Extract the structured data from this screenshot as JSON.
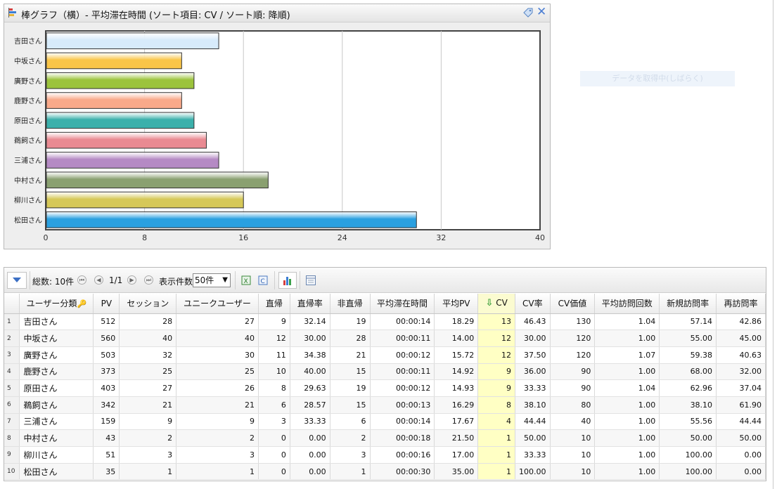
{
  "chart_panel": {
    "title": "棒グラフ（横）- 平均滞在時間 (ソート項目: CV / ソート順: 降順)"
  },
  "chart_data": {
    "type": "bar",
    "orientation": "horizontal",
    "categories": [
      "吉田さん",
      "中坂さん",
      "廣野さん",
      "鹿野さん",
      "原田さん",
      "鵜飼さん",
      "三浦さん",
      "中村さん",
      "柳川さん",
      "松田さん"
    ],
    "values": [
      14,
      11,
      12,
      11,
      12,
      13,
      14,
      18,
      16,
      30
    ],
    "xlim": [
      0,
      40
    ],
    "xticks": [
      "0",
      "8",
      "16",
      "24",
      "32",
      "40"
    ],
    "colors": [
      "#d7ebfb",
      "#f9c548",
      "#9cc33c",
      "#f9a98a",
      "#3bb0ab",
      "#e98a92",
      "#b58ac4",
      "#8aa070",
      "#d6c858",
      "#2aa0e0"
    ],
    "grid": true
  },
  "loading_stub": {
    "text": "データを取得中(しばらく)"
  },
  "toolbar": {
    "total_label": "総数: 10件",
    "page_label": "1/1",
    "page_size_label": "表示件数",
    "page_size_value": "50件"
  },
  "grid": {
    "columns": [
      "ユーザー分類",
      "PV",
      "セッション",
      "ユニークユーザー",
      "直帰",
      "直帰率",
      "非直帰",
      "平均滞在時間",
      "平均PV",
      "CV",
      "CV率",
      "CV価値",
      "平均訪問回数",
      "新規訪問率",
      "再訪問率"
    ],
    "rows": [
      {
        "n": "1",
        "name": "吉田さん",
        "pv": "512",
        "ses": "28",
        "uu": "27",
        "bnc": "9",
        "bncr": "32.14",
        "nbnc": "19",
        "time": "00:00:14",
        "apv": "18.29",
        "cv": "13",
        "cvr": "46.43",
        "cvv": "130",
        "avgv": "1.04",
        "newr": "57.14",
        "retr": "42.86"
      },
      {
        "n": "2",
        "name": "中坂さん",
        "pv": "560",
        "ses": "40",
        "uu": "40",
        "bnc": "12",
        "bncr": "30.00",
        "nbnc": "28",
        "time": "00:00:11",
        "apv": "14.00",
        "cv": "12",
        "cvr": "30.00",
        "cvv": "120",
        "avgv": "1.00",
        "newr": "55.00",
        "retr": "45.00"
      },
      {
        "n": "3",
        "name": "廣野さん",
        "pv": "503",
        "ses": "32",
        "uu": "30",
        "bnc": "11",
        "bncr": "34.38",
        "nbnc": "21",
        "time": "00:00:12",
        "apv": "15.72",
        "cv": "12",
        "cvr": "37.50",
        "cvv": "120",
        "avgv": "1.07",
        "newr": "59.38",
        "retr": "40.63"
      },
      {
        "n": "4",
        "name": "鹿野さん",
        "pv": "373",
        "ses": "25",
        "uu": "25",
        "bnc": "10",
        "bncr": "40.00",
        "nbnc": "15",
        "time": "00:00:11",
        "apv": "14.92",
        "cv": "9",
        "cvr": "36.00",
        "cvv": "90",
        "avgv": "1.00",
        "newr": "68.00",
        "retr": "32.00"
      },
      {
        "n": "5",
        "name": "原田さん",
        "pv": "403",
        "ses": "27",
        "uu": "26",
        "bnc": "8",
        "bncr": "29.63",
        "nbnc": "19",
        "time": "00:00:12",
        "apv": "14.93",
        "cv": "9",
        "cvr": "33.33",
        "cvv": "90",
        "avgv": "1.04",
        "newr": "62.96",
        "retr": "37.04"
      },
      {
        "n": "6",
        "name": "鵜飼さん",
        "pv": "342",
        "ses": "21",
        "uu": "21",
        "bnc": "6",
        "bncr": "28.57",
        "nbnc": "15",
        "time": "00:00:13",
        "apv": "16.29",
        "cv": "8",
        "cvr": "38.10",
        "cvv": "80",
        "avgv": "1.00",
        "newr": "38.10",
        "retr": "61.90"
      },
      {
        "n": "7",
        "name": "三浦さん",
        "pv": "159",
        "ses": "9",
        "uu": "9",
        "bnc": "3",
        "bncr": "33.33",
        "nbnc": "6",
        "time": "00:00:14",
        "apv": "17.67",
        "cv": "4",
        "cvr": "44.44",
        "cvv": "40",
        "avgv": "1.00",
        "newr": "55.56",
        "retr": "44.44"
      },
      {
        "n": "8",
        "name": "中村さん",
        "pv": "43",
        "ses": "2",
        "uu": "2",
        "bnc": "0",
        "bncr": "0.00",
        "nbnc": "2",
        "time": "00:00:18",
        "apv": "21.50",
        "cv": "1",
        "cvr": "50.00",
        "cvv": "10",
        "avgv": "1.00",
        "newr": "50.00",
        "retr": "50.00"
      },
      {
        "n": "9",
        "name": "柳川さん",
        "pv": "51",
        "ses": "3",
        "uu": "3",
        "bnc": "0",
        "bncr": "0.00",
        "nbnc": "3",
        "time": "00:00:16",
        "apv": "17.00",
        "cv": "1",
        "cvr": "33.33",
        "cvv": "10",
        "avgv": "1.00",
        "newr": "100.00",
        "retr": "0.00"
      },
      {
        "n": "10",
        "name": "松田さん",
        "pv": "35",
        "ses": "1",
        "uu": "1",
        "bnc": "0",
        "bncr": "0.00",
        "nbnc": "1",
        "time": "00:00:30",
        "apv": "35.00",
        "cv": "1",
        "cvr": "100.00",
        "cvv": "10",
        "avgv": "1.00",
        "newr": "100.00",
        "retr": "0.00"
      }
    ]
  },
  "icons": {
    "chart_title": "bar-chart-icon",
    "tag": "tag-icon",
    "close": "close-icon",
    "collapse": "triangle-down-icon",
    "excel": "excel-export-icon",
    "csv": "csv-export-icon",
    "chart_toggle": "chart-toggle-icon",
    "settings": "column-settings-icon"
  },
  "colors": {
    "cv_column": "#ffffc4",
    "close": "#4c7ed3"
  }
}
